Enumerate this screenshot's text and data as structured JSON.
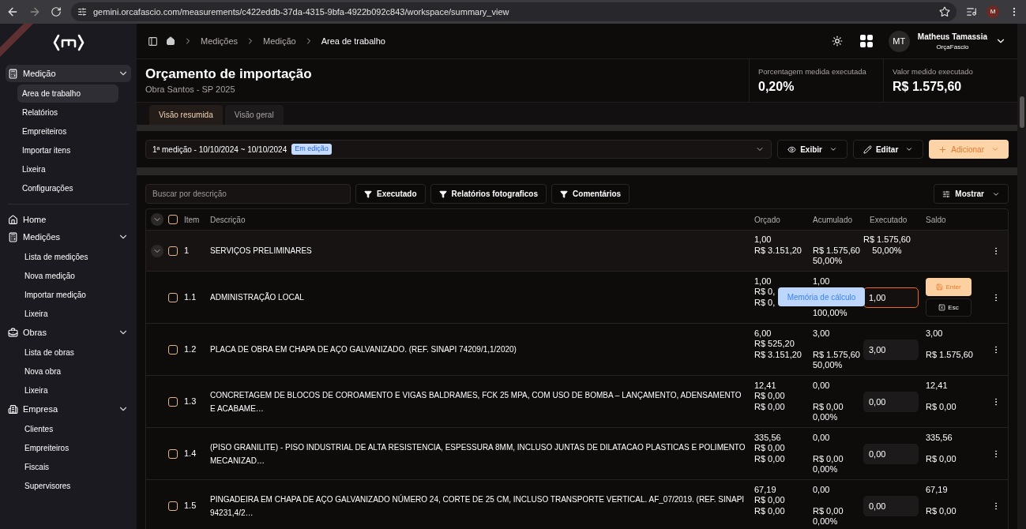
{
  "browser": {
    "url": "gemini.orcafascio.com/measurements/c422eddb-37da-4315-9bfa-4922b092c843/workspace/summary_view",
    "profile_initial": "M"
  },
  "sidebar": {
    "sections": [
      {
        "items": [
          {
            "label": "Medição",
            "selected": true,
            "expanded": true,
            "children": [
              {
                "label": "Area de trabalho",
                "selected": true
              },
              {
                "label": "Relatórios",
                "selected": false
              },
              {
                "label": "Empreiteiros",
                "selected": false
              },
              {
                "label": "Importar itens",
                "selected": false
              },
              {
                "label": "Lixeira",
                "selected": false
              },
              {
                "label": "Configurações",
                "selected": false
              }
            ]
          }
        ]
      },
      {
        "items": [
          {
            "label": "Home",
            "selected": false
          },
          {
            "label": "Medições",
            "selected": false,
            "expanded": true,
            "children": [
              {
                "label": "Lista de medições",
                "selected": false
              },
              {
                "label": "Nova medição",
                "selected": false
              },
              {
                "label": "Importar medição",
                "selected": false
              },
              {
                "label": "Lixeira",
                "selected": false
              }
            ]
          },
          {
            "label": "Obras",
            "selected": false,
            "expanded": true,
            "children": [
              {
                "label": "Lista de obras",
                "selected": false
              },
              {
                "label": "Nova obra",
                "selected": false
              },
              {
                "label": "Lixeira",
                "selected": false
              }
            ]
          },
          {
            "label": "Empresa",
            "selected": false,
            "expanded": true,
            "children": [
              {
                "label": "Clientes",
                "selected": false
              },
              {
                "label": "Empreiteiros",
                "selected": false
              },
              {
                "label": "Fiscais",
                "selected": false
              },
              {
                "label": "Supervisores",
                "selected": false
              }
            ]
          }
        ]
      }
    ]
  },
  "breadcrumbs": [
    "Medições",
    "Medição",
    "Area de trabalho"
  ],
  "user": {
    "initials": "MT",
    "name": "Matheus Tamassia",
    "organization": "OrçaFascio"
  },
  "page": {
    "title": "Orçamento de importação",
    "subtitle": "Obra Santos - SP 2025",
    "stats": [
      {
        "label": "Porcentagem medida executada",
        "value": "0,20%"
      },
      {
        "label": "Valor medido executado",
        "value": "R$ 1.575,60"
      }
    ]
  },
  "tabs": [
    {
      "label": "Visão resumida",
      "selected": true
    },
    {
      "label": "Visão geral",
      "selected": false
    }
  ],
  "measurement": {
    "text": "1ª medição - 10/10/2024 ~ 10/10/2024",
    "badge": "Em edição"
  },
  "actions": [
    {
      "label": "Exibir",
      "kind": "view"
    },
    {
      "label": "Editar",
      "kind": "edit"
    },
    {
      "label": "Adicionar",
      "kind": "add"
    }
  ],
  "search": {
    "placeholder": "Buscar por descrição"
  },
  "filters": [
    "Executado",
    "Relatórios fotograficos",
    "Comentários"
  ],
  "show_button": "Mostrar",
  "table": {
    "select_all_checked": false,
    "columns": [
      "Item",
      "Descrição",
      "Orçado",
      "Acumulado",
      "Executado",
      "Saldo"
    ],
    "rows": [
      {
        "kind": "group",
        "item": "1",
        "description": "SERVIÇOS PRELIMINARES",
        "expanded": true,
        "checked": false,
        "orcado": [
          "1,00",
          "R$ 3.151,20"
        ],
        "acumulado": {
          "value": "R$ 1.575,60",
          "percent": "50,00%"
        },
        "executado": {
          "value": "R$ 1.575,60",
          "percent": "50,00%"
        }
      },
      {
        "kind": "item",
        "item": "1.1",
        "description": "ADMINISTRAÇÃO LOCAL",
        "checked": false,
        "orcado": [
          "1,00",
          "R$ 0,",
          "R$ 0,"
        ],
        "acumulado": {
          "quantity": "1,00",
          "percent": "100,00%"
        },
        "executado": {
          "input": "1,00",
          "focused": true
        },
        "editing": {
          "tooltip": "Memória de cálculo",
          "save": "Enter",
          "cancel": "Esc"
        }
      },
      {
        "kind": "item",
        "item": "1.2",
        "description": "PLACA DE OBRA EM CHAPA DE AÇO GALVANIZADO. (REF. SINAPI 74209/1,1/2020)",
        "checked": false,
        "orcado": [
          "6,00",
          "R$ 525,20",
          "R$ 3.151,20"
        ],
        "acumulado": {
          "quantity": "3,00",
          "value": "R$ 1.575,60",
          "percent": "50,00%"
        },
        "executado": {
          "input": "3,00",
          "focused": false
        },
        "saldo": {
          "quantity": "3,00",
          "value": "R$ 1.575,60"
        }
      },
      {
        "kind": "item",
        "item": "1.3",
        "description": "CONCRETAGEM DE BLOCOS DE COROAMENTO E VIGAS BALDRAMES, FCK 25 MPA, COM USO DE BOMBA – LANÇAMENTO, ADENSAMENTO E ACABAME…",
        "checked": false,
        "orcado": [
          "12,41",
          "R$ 0,00",
          "R$ 0,00"
        ],
        "acumulado": {
          "quantity": "0,00",
          "value": "R$ 0,00",
          "percent": "0,00%"
        },
        "executado": {
          "input": "0,00",
          "focused": false
        },
        "saldo": {
          "quantity": "12,41",
          "value": "R$ 0,00"
        }
      },
      {
        "kind": "item",
        "item": "1.4",
        "description": "(PISO GRANILITE) - PISO INDUSTRIAL DE ALTA RESISTENCIA, ESPESSURA 8MM, INCLUSO JUNTAS DE DILATACAO PLASTICAS E POLIMENTO MECANIZAD…",
        "checked": false,
        "orcado": [
          "335,56",
          "R$ 0,00",
          "R$ 0,00"
        ],
        "acumulado": {
          "quantity": "0,00",
          "value": "R$ 0,00",
          "percent": "0,00%"
        },
        "executado": {
          "input": "0,00",
          "focused": false
        },
        "saldo": {
          "quantity": "335,56",
          "value": "R$ 0,00"
        }
      },
      {
        "kind": "item",
        "item": "1.5",
        "description": "PINGADEIRA EM CHAPA DE AÇO GALVANIZADO NÚMERO 24, CORTE DE 25 CM, INCLUSO TRANSPORTE VERTICAL. AF_07/2019. (REF. SINAPI 94231,4/2…",
        "checked": false,
        "orcado": [
          "67,19",
          "R$ 0,00",
          "R$ 0,00"
        ],
        "acumulado": {
          "quantity": "0,00",
          "value": "R$ 0,00",
          "percent": "0,00%"
        },
        "executado": {
          "input": "0,00",
          "focused": false
        },
        "saldo": {
          "quantity": "67,19",
          "value": "R$ 0,00"
        }
      }
    ]
  }
}
